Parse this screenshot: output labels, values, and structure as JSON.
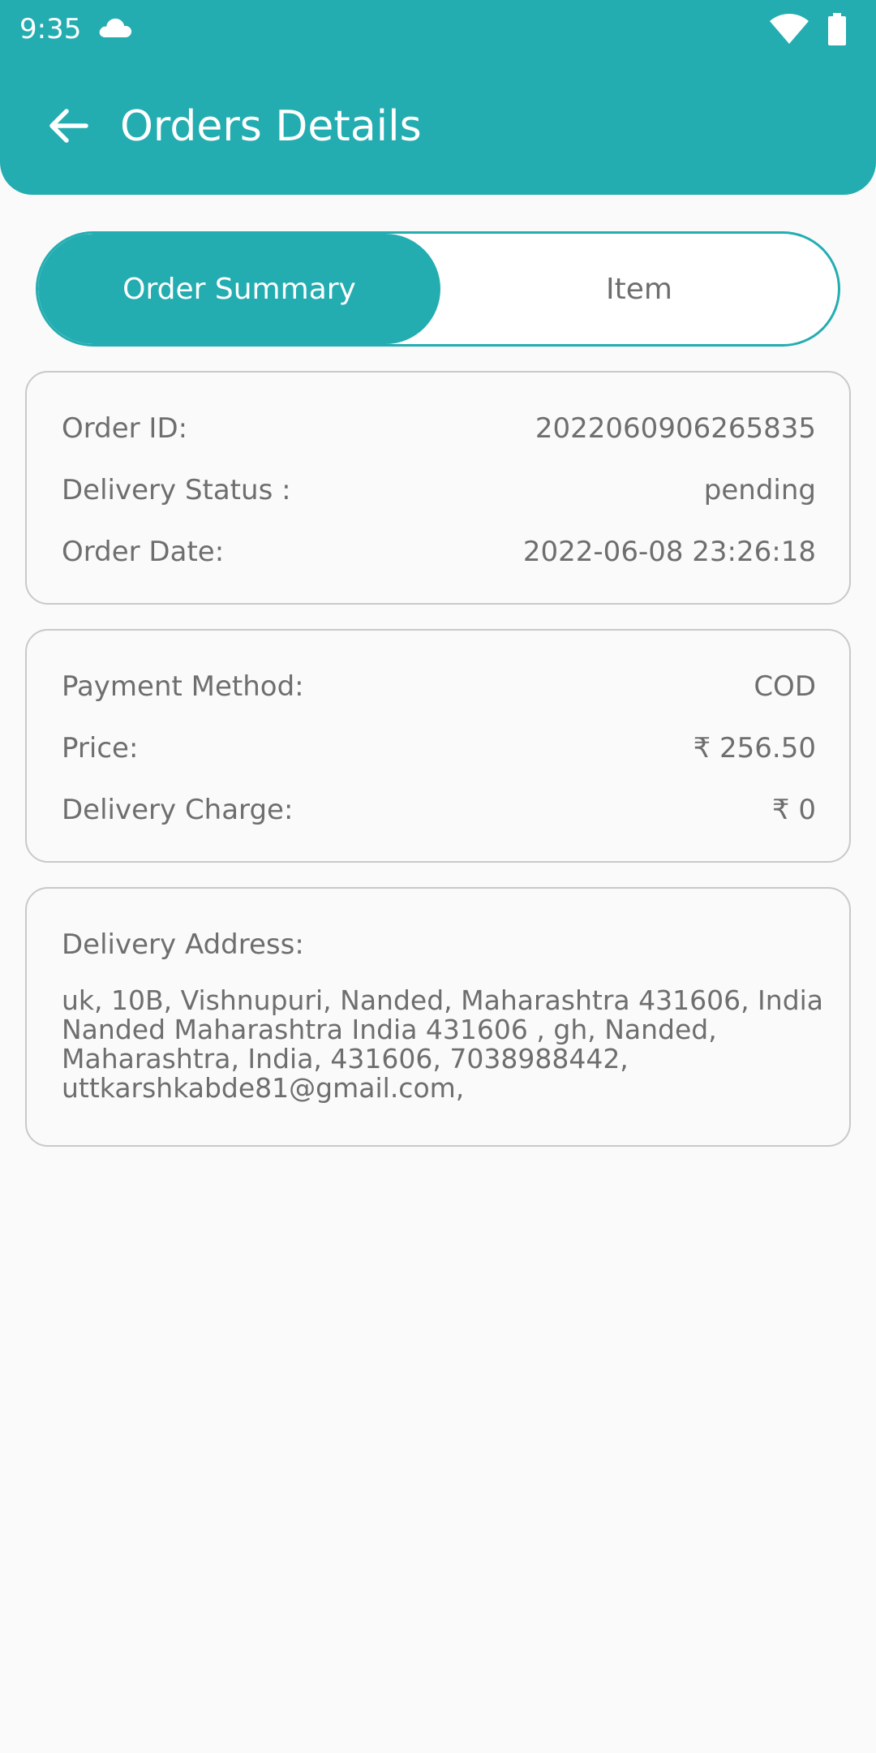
{
  "status_bar": {
    "time": "9:35",
    "icons": [
      "cloud-icon",
      "wifi-icon",
      "battery-icon"
    ]
  },
  "header": {
    "title": "Orders Details",
    "back_icon": "arrow-back-icon"
  },
  "tabs": [
    {
      "label": "Order Summary",
      "active": true
    },
    {
      "label": "Item",
      "active": false
    }
  ],
  "order_info": {
    "order_id_label": "Order ID:",
    "order_id_value": "2022060906265835",
    "delivery_status_label": "Delivery Status :",
    "delivery_status_value": "pending",
    "order_date_label": "Order Date:",
    "order_date_value": "2022-06-08 23:26:18"
  },
  "payment_info": {
    "payment_method_label": "Payment Method:",
    "payment_method_value": "COD",
    "price_label": "Price:",
    "price_value": "₹ 256.50",
    "delivery_charge_label": "Delivery Charge:",
    "delivery_charge_value": "₹ 0"
  },
  "address": {
    "label": "Delivery Address:",
    "text": "uk, 10B, Vishnupuri, Nanded, Maharashtra 431606, India Nanded Maharashtra India 431606 , gh, Nanded, Maharashtra, India, 431606, 7038988442, uttkarshkabde81@gmail.com,"
  },
  "colors": {
    "accent": "#24adb1",
    "text": "#6e6e6e",
    "border": "#c9c9c9",
    "background": "#fafafa"
  }
}
